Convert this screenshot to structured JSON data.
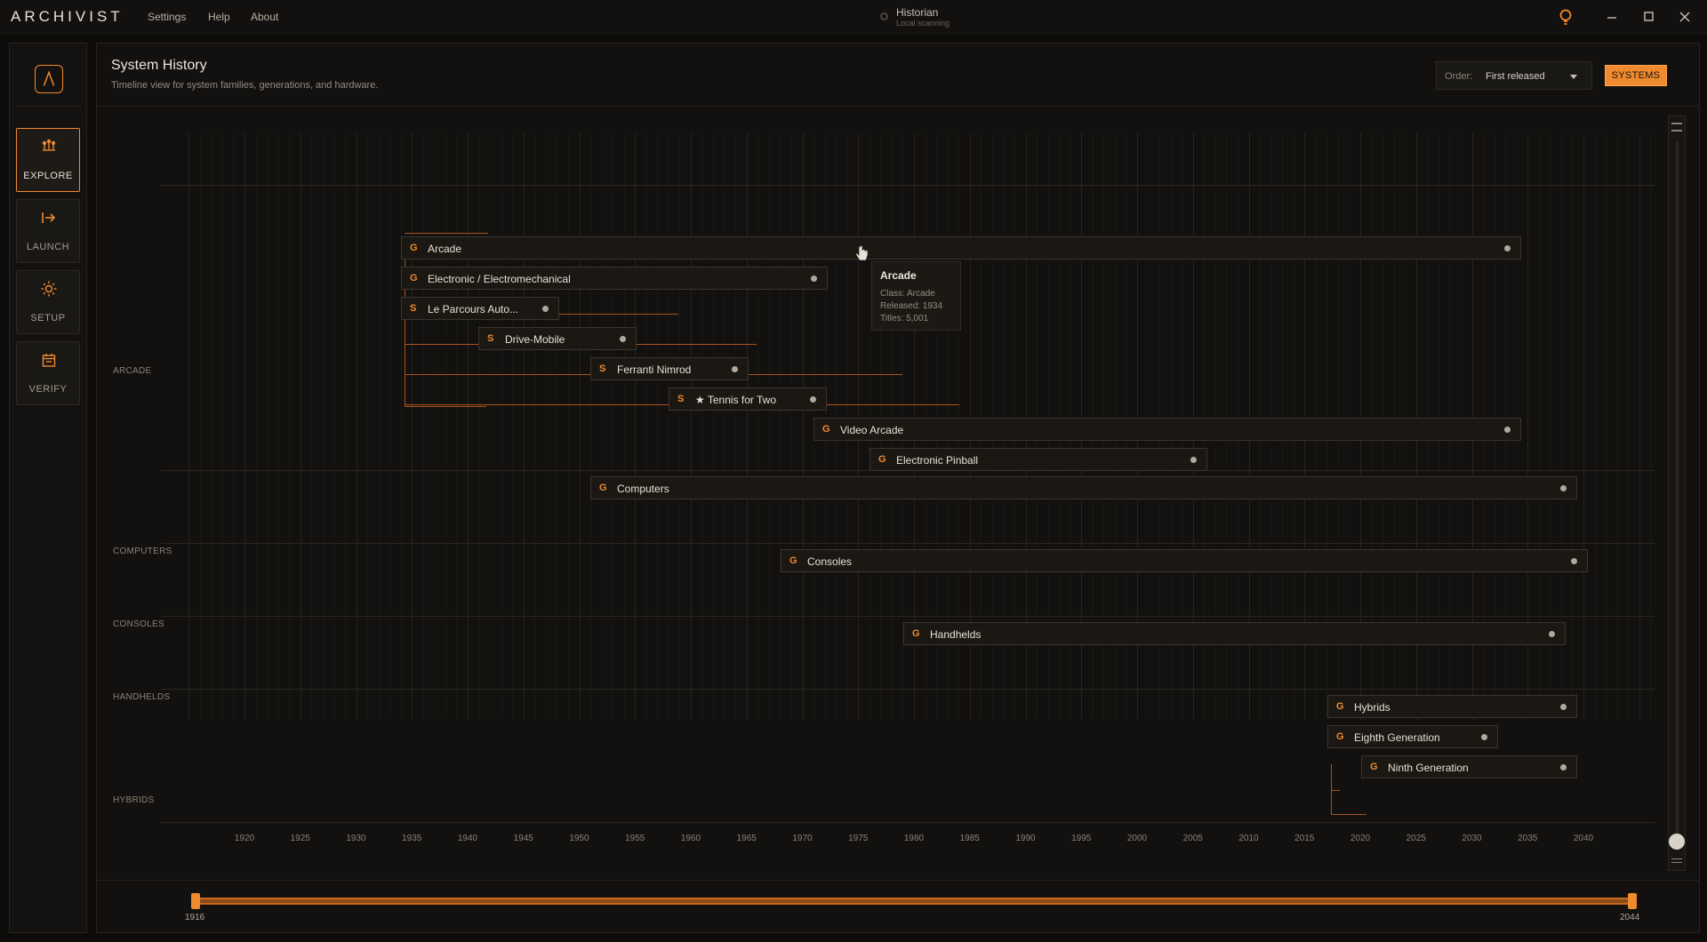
{
  "app": {
    "logo": "ARCHIVIST",
    "menu": [
      "Settings",
      "Help",
      "About"
    ],
    "status_title": "Historian",
    "status_sub": "Local scanning"
  },
  "sidenav": {
    "items": [
      {
        "label": "EXPLORE",
        "icon": "explore-icon",
        "active": true
      },
      {
        "label": "LAUNCH",
        "icon": "launch-icon",
        "active": false
      },
      {
        "label": "SETUP",
        "icon": "setup-sun-icon",
        "active": false
      },
      {
        "label": "VERIFY",
        "icon": "verify-calendar-icon",
        "active": false
      }
    ]
  },
  "header": {
    "title": "System History",
    "subtitle": "Timeline view for system families, generations, and hardware.",
    "order_label": "Order:",
    "order_value": "First released",
    "systems_button": "SYSTEMS"
  },
  "groups": [
    "ARCADE",
    "COMPUTERS",
    "CONSOLES",
    "HANDHELDS",
    "HYBRIDS"
  ],
  "timeline": {
    "bars": [
      {
        "badge": "G",
        "label": "Arcade"
      },
      {
        "badge": "G",
        "label": "Electronic / Electromechanical"
      },
      {
        "badge": "S",
        "label": "Le Parcours Auto..."
      },
      {
        "badge": "S",
        "label": "Drive-Mobile"
      },
      {
        "badge": "S",
        "label": "Ferranti Nimrod"
      },
      {
        "badge": "S",
        "label": "★ Tennis for Two"
      },
      {
        "badge": "G",
        "label": "Video Arcade"
      },
      {
        "badge": "G",
        "label": "Electronic Pinball"
      },
      {
        "badge": "G",
        "label": "Computers"
      },
      {
        "badge": "G",
        "label": "Consoles"
      },
      {
        "badge": "G",
        "label": "Handhelds"
      },
      {
        "badge": "G",
        "label": "Hybrids"
      },
      {
        "badge": "G",
        "label": "Eighth Generation"
      },
      {
        "badge": "G",
        "label": "Ninth Generation"
      }
    ],
    "axis_years": [
      "1920",
      "1925",
      "1930",
      "1935",
      "1940",
      "1945",
      "1950",
      "1955",
      "1960",
      "1965",
      "1970",
      "1975",
      "1980",
      "1985",
      "1990",
      "1995",
      "2000",
      "2005",
      "2010",
      "2015",
      "2020",
      "2025",
      "2030",
      "2035",
      "2040"
    ]
  },
  "tooltip": {
    "title": "Arcade",
    "class_line": "Class: Arcade",
    "released_line": "Released: 1934",
    "titles_line": "Titles: 5,001"
  },
  "range": {
    "start": "1916",
    "end": "2044"
  },
  "colors": {
    "accent": "#f08a2e",
    "background": "#0d0c0b",
    "panel": "#12110f"
  }
}
